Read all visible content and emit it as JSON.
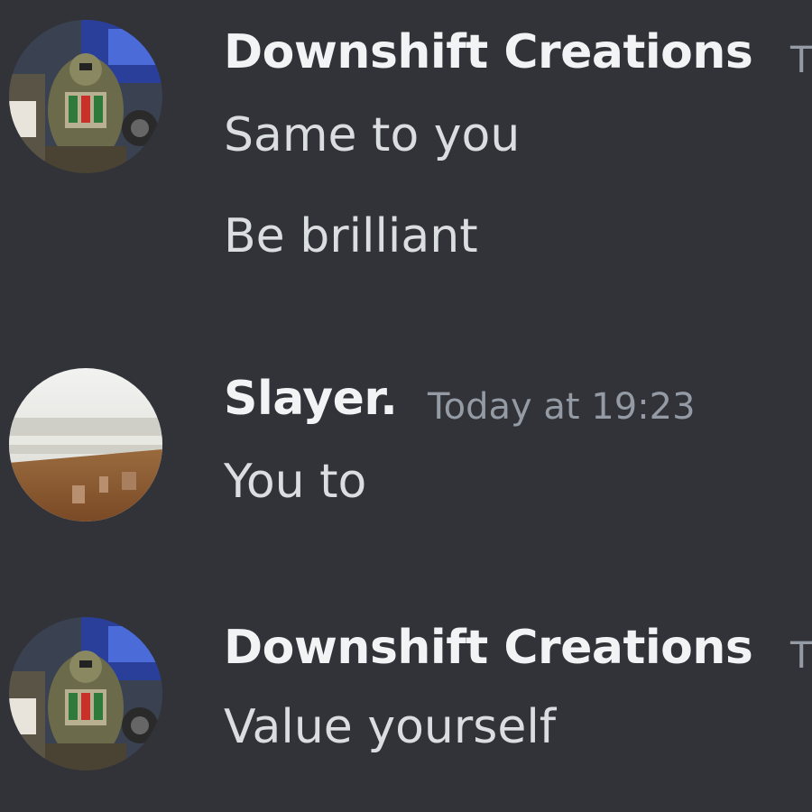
{
  "messages": [
    {
      "author": "Downshift Creations",
      "timestamp": "T",
      "lines": [
        "Same to you",
        "Be brilliant"
      ]
    },
    {
      "author": "Slayer.",
      "timestamp": "Today at 19:23",
      "lines": [
        "You to"
      ]
    },
    {
      "author": "Downshift Creations",
      "timestamp": "T",
      "lines": [
        "Value yourself"
      ]
    }
  ],
  "colors": {
    "background": "#313338",
    "username": "#f2f3f5",
    "message_text": "#dbdee1",
    "timestamp": "#949ba4"
  }
}
